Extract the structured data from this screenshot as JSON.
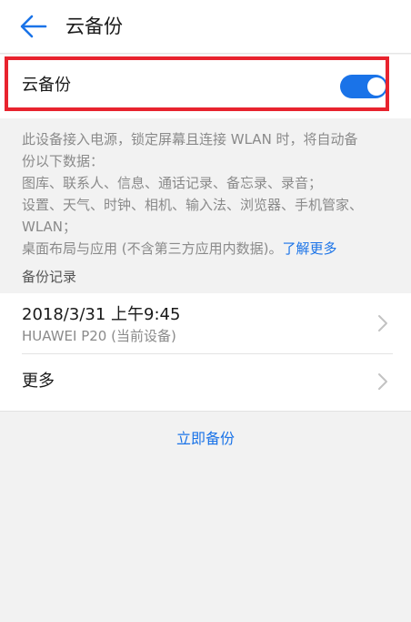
{
  "header": {
    "title": "云备份",
    "back_icon": "arrow-left-icon"
  },
  "cloud_backup": {
    "label": "云备份",
    "enabled": true,
    "toggle_color": "#1a73e8",
    "highlight_color": "#e8232e"
  },
  "description": {
    "lines": [
      "此设备接入电源，锁定屏幕且连接 WLAN 时，将自动备",
      "份以下数据：",
      "图库、联系人、信息、通话记录、备忘录、录音；",
      "设置、天气、时钟、相机、输入法、浏览器、手机管家、",
      "WLAN；",
      "桌面布局与应用 (不含第三方应用内数据)。"
    ],
    "learn_more": "了解更多"
  },
  "records_section": {
    "title": "备份记录",
    "items": [
      {
        "date": "2018/3/31 上午9:45",
        "device": "HUAWEI P20 (当前设备)"
      }
    ],
    "more_label": "更多"
  },
  "actions": {
    "backup_now": "立即备份"
  },
  "icons": {
    "chevron": "chevron-right-icon"
  }
}
